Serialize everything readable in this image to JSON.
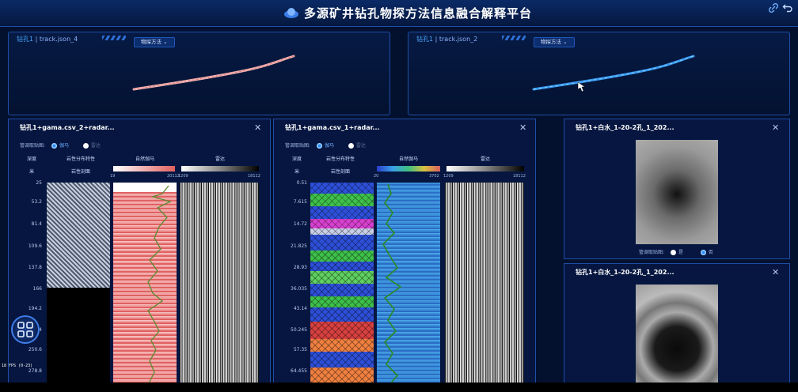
{
  "app": {
    "title": "多源矿井钻孔物探方法信息融合解释平台",
    "fps_text": "18 FPS (0-23)"
  },
  "track_panels": [
    {
      "hole": "钻孔1",
      "file": "| track.json_4",
      "method_label": "物探方法"
    },
    {
      "hole": "钻孔1",
      "file": "| track.json_2",
      "method_label": "物探方法"
    }
  ],
  "log_panels": [
    {
      "title": "钻孔1+gama.csv_2+radar...",
      "mode_label": "管调取贴图:",
      "mode_on": "伽马",
      "mode_off": "雷达",
      "col_depth": "深度",
      "col_depth_unit": "米",
      "col_lith": "岩性分布特性",
      "col_lith_sub": "岩性剖面",
      "col_gamma": "自然伽马",
      "col_radar": "雷达",
      "gamma_min": "19",
      "gamma_max": "20112",
      "radar_min": "1209",
      "radar_max": "18112",
      "depths": [
        "25",
        "53.2",
        "81.4",
        "109.6",
        "137.8",
        "166",
        "194.2",
        "222.4",
        "250.6",
        "278.8"
      ]
    },
    {
      "title": "钻孔1+gama.csv_1+radar...",
      "mode_label": "管调取贴图:",
      "mode_on": "伽马",
      "mode_off": "雷达",
      "col_depth": "深度",
      "col_depth_unit": "米",
      "col_lith": "岩性分布特性",
      "col_lith_sub": "岩性剖面",
      "col_gamma": "自然伽马",
      "col_radar": "雷达",
      "gamma_min": "20",
      "gamma_max": "3702",
      "radar_min": "1209",
      "radar_max": "18112",
      "depths": [
        "0.51",
        "7.615",
        "14.72",
        "21.825",
        "28.93",
        "36.035",
        "43.14",
        "50.245",
        "57.35",
        "64.455"
      ]
    }
  ],
  "image_panels": [
    {
      "title": "钻孔1+白水_1-20-2孔_1_202...",
      "toggle_label": "管调取贴图:",
      "opt_yes": "是",
      "opt_no": "否"
    },
    {
      "title": "钻孔1+白水_1-20-2孔_1_202..."
    }
  ],
  "colors": {
    "accent": "#2d8cff",
    "background": "#03102e",
    "panel_border": "#1e4ea6"
  }
}
